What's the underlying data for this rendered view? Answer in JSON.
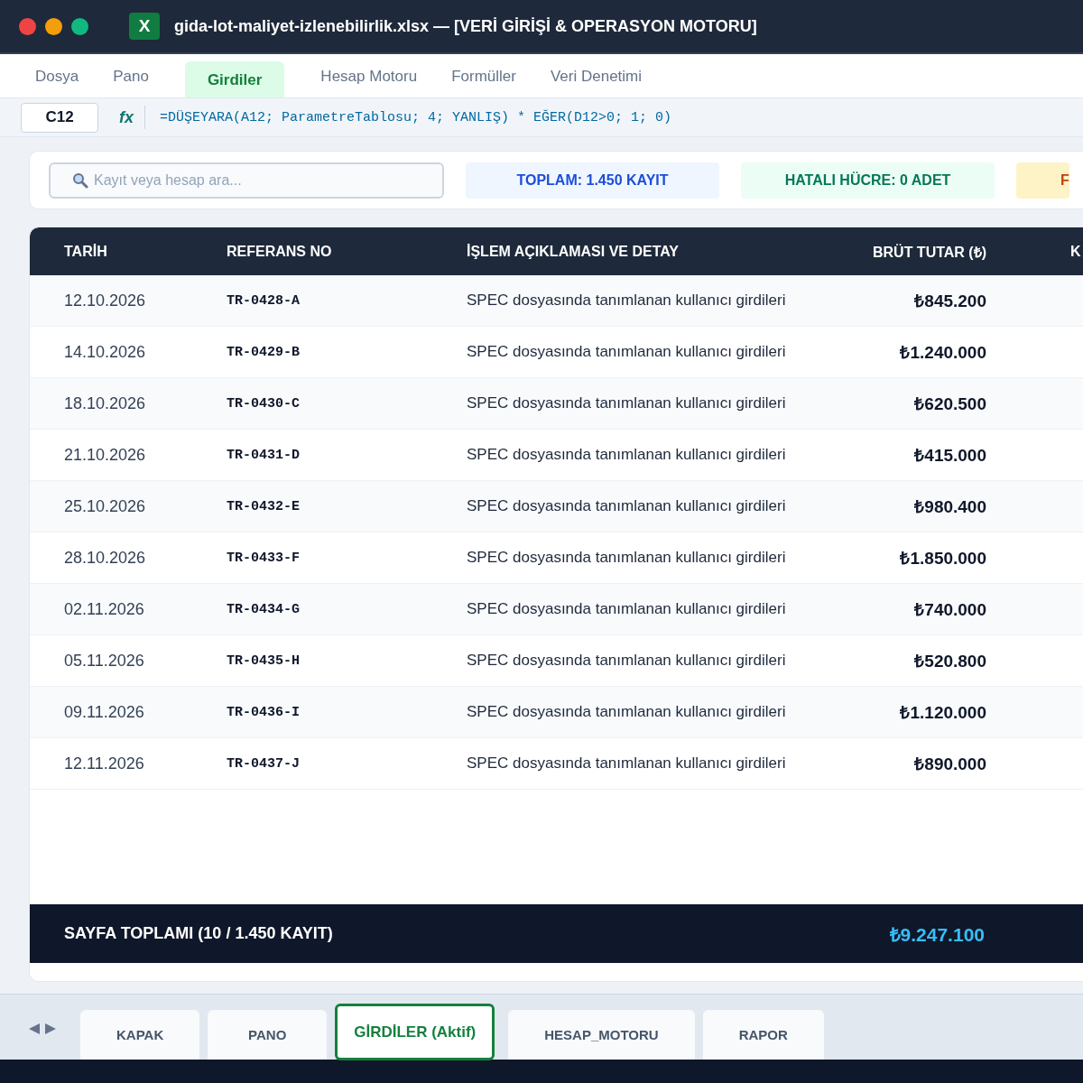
{
  "window": {
    "title": "gida-lot-maliyet-izlenebilirlik.xlsx — [VERİ GİRİŞİ & OPERASYON MOTORU]",
    "logo_text": "X"
  },
  "menu": [
    {
      "label": "Dosya",
      "selected": false
    },
    {
      "label": "Pano",
      "selected": false
    },
    {
      "label": "Girdiler",
      "selected": true
    },
    {
      "label": "Hesap Motoru",
      "selected": false
    },
    {
      "label": "Formüller",
      "selected": false
    },
    {
      "label": "Veri Denetimi",
      "selected": false
    }
  ],
  "formula_bar": {
    "cell_ref": "C12",
    "fx_label": "fx",
    "formula": "=DÜŞEYARA(A12; ParametreTablosu; 4; YANLIŞ) * EĞER(D12>0; 1; 0)"
  },
  "search": {
    "placeholder": "Kayıt veya hesap ara..."
  },
  "badges": [
    {
      "text": "TOPLAM: 1.450 KAYIT",
      "kind": "info"
    },
    {
      "text": "HATALI HÜCRE: 0 ADET",
      "kind": "success"
    },
    {
      "text": "F",
      "kind": "warning"
    }
  ],
  "table": {
    "columns": [
      "TARİH",
      "REFERANS NO",
      "İŞLEM AÇIKLAMASI VE DETAY",
      "BRÜT TUTAR (₺)",
      "K"
    ],
    "rows": [
      {
        "date": "12.10.2026",
        "ref": "TR-0428-A",
        "description": "SPEC dosyasında tanımlanan kullanıcı girdileri",
        "amount": "₺845.200"
      },
      {
        "date": "14.10.2026",
        "ref": "TR-0429-B",
        "description": "SPEC dosyasında tanımlanan kullanıcı girdileri",
        "amount": "₺1.240.000"
      },
      {
        "date": "18.10.2026",
        "ref": "TR-0430-C",
        "description": "SPEC dosyasında tanımlanan kullanıcı girdileri",
        "amount": "₺620.500"
      },
      {
        "date": "21.10.2026",
        "ref": "TR-0431-D",
        "description": "SPEC dosyasında tanımlanan kullanıcı girdileri",
        "amount": "₺415.000"
      },
      {
        "date": "25.10.2026",
        "ref": "TR-0432-E",
        "description": "SPEC dosyasında tanımlanan kullanıcı girdileri",
        "amount": "₺980.400"
      },
      {
        "date": "28.10.2026",
        "ref": "TR-0433-F",
        "description": "SPEC dosyasında tanımlanan kullanıcı girdileri",
        "amount": "₺1.850.000"
      },
      {
        "date": "02.11.2026",
        "ref": "TR-0434-G",
        "description": "SPEC dosyasında tanımlanan kullanıcı girdileri",
        "amount": "₺740.000"
      },
      {
        "date": "05.11.2026",
        "ref": "TR-0435-H",
        "description": "SPEC dosyasında tanımlanan kullanıcı girdileri",
        "amount": "₺520.800"
      },
      {
        "date": "09.11.2026",
        "ref": "TR-0436-I",
        "description": "SPEC dosyasında tanımlanan kullanıcı girdileri",
        "amount": "₺1.120.000"
      },
      {
        "date": "12.11.2026",
        "ref": "TR-0437-J",
        "description": "SPEC dosyasında tanımlanan kullanıcı girdileri",
        "amount": "₺890.000"
      }
    ],
    "footer": {
      "label": "SAYFA TOPLAMI (10 / 1.450 KAYIT)",
      "total": "₺9.247.100"
    }
  },
  "sheet_tabs": [
    {
      "label": "KAPAK",
      "selected": false
    },
    {
      "label": "PANO",
      "selected": false
    },
    {
      "label": "GİRDİLER (Aktif)",
      "selected": true
    },
    {
      "label": "HESAP_MOTORU",
      "selected": false
    },
    {
      "label": "RAPOR",
      "selected": false
    }
  ]
}
